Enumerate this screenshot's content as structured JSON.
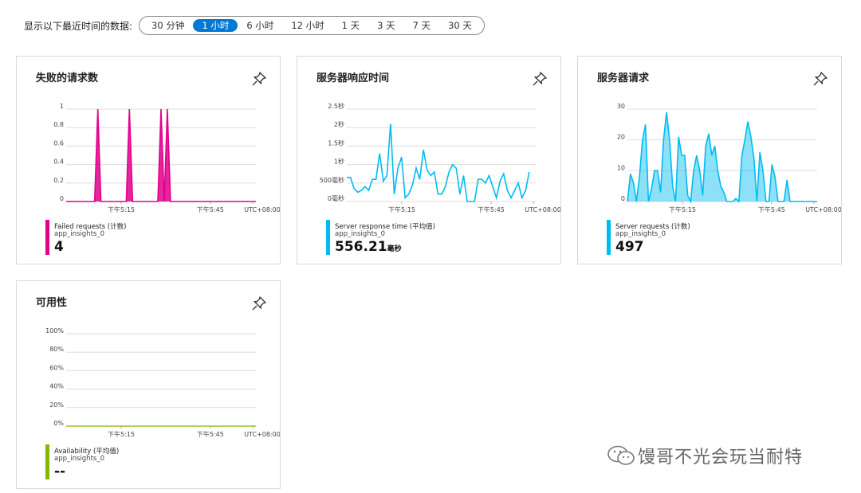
{
  "time_range": {
    "label": "显示以下最近时间的数据:",
    "options": [
      "30 分钟",
      "1 小时",
      "6 小时",
      "12 小时",
      "1 天",
      "3 天",
      "7 天",
      "30 天"
    ],
    "selected": "1 小时"
  },
  "colors": {
    "failed": "#e3008c",
    "response": "#00bcf2",
    "requests": "#00bcf2",
    "availability": "#7fba00",
    "grid": "#dddddd",
    "active_pill": "#0078d4"
  },
  "cards": [
    {
      "id": "failed",
      "title": "失败的请求数",
      "legend": {
        "series": "Failed requests (计数)",
        "sub": "app_insights_0",
        "value": "4",
        "unit": ""
      }
    },
    {
      "id": "response",
      "title": "服务器响应时间",
      "legend": {
        "series": "Server response time (平均值)",
        "sub": "app_insights_0",
        "value": "556.21",
        "unit": "毫秒"
      }
    },
    {
      "id": "requests",
      "title": "服务器请求",
      "legend": {
        "series": "Server requests (计数)",
        "sub": "app_insights_0",
        "value": "497",
        "unit": ""
      }
    },
    {
      "id": "availability",
      "title": "可用性",
      "legend": {
        "series": "Availability (平均值)",
        "sub": "app_insights_0",
        "value": "--",
        "unit": ""
      }
    }
  ],
  "watermark": "馒哥不光会玩当耐特",
  "chart_data": [
    {
      "id": "failed",
      "type": "area",
      "x_tick_labels": [
        "下午5:15",
        "下午5:45",
        "UTC+08:00"
      ],
      "y_tick_labels": [
        "1",
        "0.8",
        "0.6",
        "0.4",
        "0.2",
        "0"
      ],
      "ylim": [
        0,
        1
      ],
      "grid": true,
      "series": [
        {
          "name": "Failed requests (计数)",
          "x": [
            0,
            9,
            10,
            11,
            19,
            20,
            21,
            29,
            30,
            31,
            32,
            33,
            35,
            60
          ],
          "y": [
            0,
            0,
            1,
            0,
            0,
            1,
            0,
            0,
            1,
            0,
            1,
            0,
            0,
            0
          ]
        }
      ],
      "x_max": 60
    },
    {
      "id": "response",
      "type": "line",
      "x_tick_labels": [
        "下午5:15",
        "下午5:45",
        "UTC+08:00"
      ],
      "y_tick_labels": [
        "2.5秒",
        "2秒",
        "1.5秒",
        "1秒",
        "500毫秒",
        "0毫秒"
      ],
      "ylim": [
        0,
        2.5
      ],
      "grid": true,
      "series": [
        {
          "name": "Server response time (平均值)",
          "x": [
            0,
            1,
            2,
            3,
            4,
            5,
            6,
            7,
            8,
            9,
            10,
            11,
            12,
            13,
            14,
            15,
            16,
            17,
            18,
            19,
            20,
            21,
            22,
            23,
            24,
            25,
            26,
            27,
            28,
            29,
            30,
            31,
            32,
            33,
            34,
            35,
            36,
            37,
            38,
            39,
            40,
            41,
            42,
            43,
            44,
            45,
            46,
            47,
            48,
            49,
            50
          ],
          "y": [
            0.65,
            0.65,
            0.35,
            0.25,
            0.3,
            0.4,
            0.3,
            0.6,
            0.6,
            1.3,
            0.55,
            0.7,
            2.1,
            0.2,
            0.9,
            1.2,
            0.1,
            0.2,
            0.45,
            0.9,
            0.6,
            1.4,
            0.85,
            0.7,
            0.8,
            0.2,
            0.2,
            0.4,
            0.8,
            1.0,
            0.9,
            0.2,
            0.7,
            0.0,
            0.0,
            0.0,
            0.6,
            0.6,
            0.5,
            0.7,
            0.4,
            0.1,
            0.55,
            0.75,
            0.3,
            0.1,
            0.3,
            0.5,
            0.1,
            0.3,
            0.8
          ]
        }
      ],
      "x_max": 52
    },
    {
      "id": "requests",
      "type": "area",
      "x_tick_labels": [
        "下午5:15",
        "下午5:45",
        "UTC+08:00"
      ],
      "y_tick_labels": [
        "30",
        "20",
        "10",
        "0"
      ],
      "ylim": [
        0,
        30
      ],
      "grid": true,
      "series": [
        {
          "name": "Server requests (计数)",
          "x": [
            0,
            1,
            2,
            3,
            4,
            5,
            6,
            7,
            8,
            9,
            10,
            11,
            12,
            13,
            14,
            15,
            16,
            17,
            18,
            19,
            20,
            21,
            22,
            23,
            24,
            25,
            26,
            27,
            28,
            29,
            30,
            31,
            32,
            33,
            34,
            35,
            36,
            37,
            38,
            39,
            40,
            41,
            42,
            43,
            44,
            45,
            46,
            47,
            48,
            49,
            50,
            51,
            52,
            53,
            54,
            55,
            56,
            57,
            58,
            59,
            60,
            61,
            62,
            63
          ],
          "y": [
            0,
            9,
            6,
            0,
            8,
            20,
            25,
            0,
            4,
            10,
            10,
            3,
            20,
            29,
            20,
            5,
            0,
            21,
            15,
            15,
            2,
            0,
            10,
            15,
            10,
            2,
            18,
            22,
            15,
            18,
            10,
            5,
            3,
            0,
            0,
            0,
            1,
            0,
            15,
            20,
            26,
            21,
            14,
            0,
            16,
            10,
            0,
            0,
            12,
            8,
            0,
            0,
            0,
            7,
            0,
            0,
            0,
            0,
            0,
            0,
            0,
            0,
            0,
            0
          ]
        }
      ],
      "x_max": 63
    },
    {
      "id": "availability",
      "type": "line",
      "x_tick_labels": [
        "下午5:15",
        "下午5:45",
        "UTC+08:00"
      ],
      "y_tick_labels": [
        "100%",
        "80%",
        "60%",
        "40%",
        "20%",
        "0%"
      ],
      "ylim": [
        0,
        100
      ],
      "grid": true,
      "series": [
        {
          "name": "Availability (平均值)",
          "x": [
            0,
            60
          ],
          "y": [
            0,
            0
          ]
        }
      ],
      "x_max": 60
    }
  ]
}
